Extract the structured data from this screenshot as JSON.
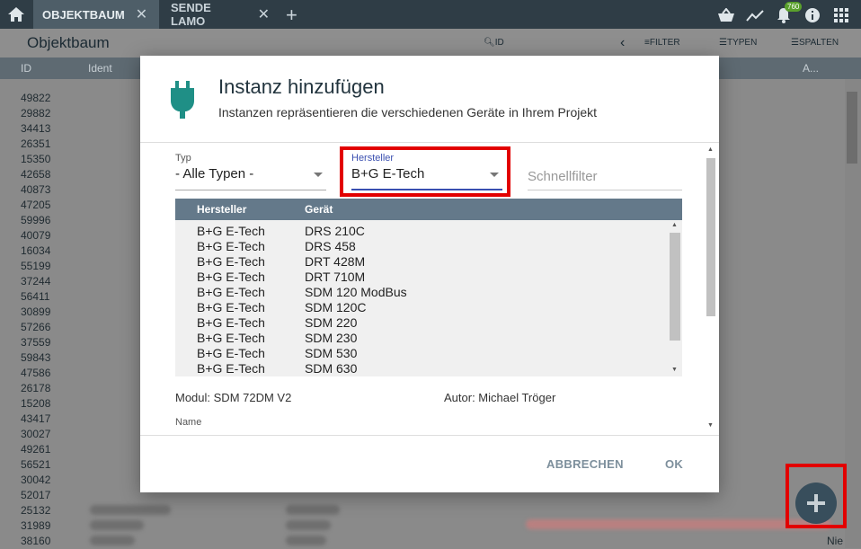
{
  "topbar": {
    "tabs": [
      {
        "label": "OBJEKTBAUM"
      },
      {
        "label": "SENDE LAMO"
      }
    ],
    "notification_count": "760"
  },
  "subbar": {
    "title": "Objektbaum",
    "search_label": "ID",
    "filter_label": "FILTER",
    "types_label": "TYPEN",
    "columns_label": "SPALTEN"
  },
  "column_headers": {
    "id": "ID",
    "ident": "Ident",
    "a": "A..."
  },
  "background_ids": [
    "49822",
    "29882",
    "34413",
    "26351",
    "15350",
    "42658",
    "40873",
    "47205",
    "59996",
    "40079",
    "16034",
    "55199",
    "37244",
    "56411",
    "30899",
    "57266",
    "37559",
    "59843",
    "47586",
    "26178",
    "15208",
    "43417",
    "30027",
    "49261",
    "56521",
    "30042",
    "52017",
    "25132",
    "31989",
    "38160"
  ],
  "background_extra": {
    "nie": "Nie"
  },
  "dialog": {
    "title": "Instanz hinzufügen",
    "subtitle": "Instanzen repräsentieren die verschiedenen Geräte in Ihrem Projekt",
    "type_field": {
      "label": "Typ",
      "value": "- Alle Typen -"
    },
    "manufacturer_field": {
      "label": "Hersteller",
      "value": "B+G E-Tech"
    },
    "quickfilter": {
      "placeholder": "Schnellfilter"
    },
    "table": {
      "headers": [
        "Hersteller",
        "Gerät"
      ],
      "rows": [
        [
          "B+G E-Tech",
          "DRS 210C"
        ],
        [
          "B+G E-Tech",
          "DRS 458"
        ],
        [
          "B+G E-Tech",
          "DRT 428M"
        ],
        [
          "B+G E-Tech",
          "DRT 710M"
        ],
        [
          "B+G E-Tech",
          "SDM 120 ModBus"
        ],
        [
          "B+G E-Tech",
          "SDM 120C"
        ],
        [
          "B+G E-Tech",
          "SDM 220"
        ],
        [
          "B+G E-Tech",
          "SDM 230"
        ],
        [
          "B+G E-Tech",
          "SDM 530"
        ],
        [
          "B+G E-Tech",
          "SDM 630"
        ]
      ]
    },
    "module": "Modul: SDM 72DM V2",
    "author": "Autor: Michael Tröger",
    "name_label": "Name",
    "cancel_label": "ABBRECHEN",
    "ok_label": "OK"
  },
  "colors": {
    "topbar": "#2f3d46",
    "accent": "#3a4fb0",
    "table_header": "#64798a",
    "highlight": "#e20000",
    "plug_icon": "#1f8f86"
  }
}
